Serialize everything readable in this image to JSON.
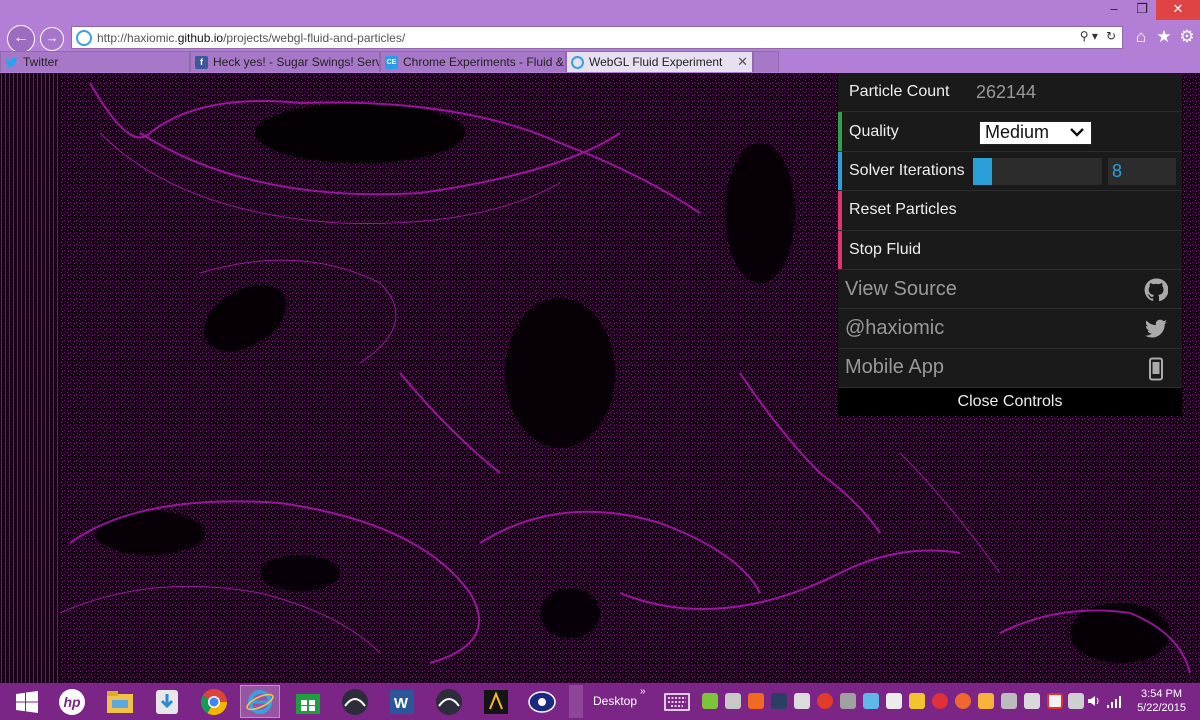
{
  "window": {
    "minimize": "–",
    "maximize": "❐",
    "close": "✕"
  },
  "nav": {
    "back": "←",
    "forward": "→"
  },
  "address": {
    "url_prefix": "http://haxiomic.",
    "url_domain": "github.io",
    "url_path": "/projects/webgl-fluid-and-particles/",
    "search_glyph": "⚲ ▾",
    "refresh_glyph": "↻"
  },
  "toolbar_icons": {
    "home": "⌂",
    "favorites": "★",
    "tools": "⚙"
  },
  "tabs": [
    {
      "label": "Twitter",
      "favicon": "twitter-icon",
      "color": "#2aa3ef"
    },
    {
      "label": "Heck yes! - Sugar Swings! Serv...",
      "favicon": "facebook-icon",
      "color": "#3b5998",
      "glyph": "f"
    },
    {
      "label": "Chrome Experiments - Fluid & ...",
      "favicon": "chrome-experiments-icon",
      "color": "#2d9be8",
      "glyph": "CE"
    },
    {
      "label": "WebGL Fluid Experiment",
      "favicon": "ie-icon",
      "color": "#3aa0e0",
      "active": true,
      "close": "✕"
    }
  ],
  "controls": {
    "particle_count_label": "Particle Count",
    "particle_count_value": "262144",
    "quality_label": "Quality",
    "quality_value": "Medium",
    "solver_label": "Solver Iterations",
    "solver_value": "8",
    "solver_fraction": 0.15,
    "reset_label": "Reset Particles",
    "stop_label": "Stop Fluid",
    "view_source_label": "View Source",
    "twitter_label": "@haxiomic",
    "mobile_label": "Mobile App",
    "close_label": "Close Controls"
  },
  "taskbar": {
    "desktop_label": "Desktop",
    "desktop_chevron": "»",
    "time": "3:54 PM",
    "date": "5/22/2015",
    "apps": [
      "windows-start-icon",
      "hp-icon",
      "file-explorer-icon",
      "download-icon",
      "chrome-icon",
      "internet-explorer-icon",
      "store-icon",
      "app-icon",
      "word-icon",
      "app-icon-2",
      "adobe-icon",
      "media-icon"
    ]
  },
  "colors": {
    "accent_green": "#2fa14a",
    "accent_blue": "#2a9fd8",
    "accent_pink": "#e2336f",
    "particles": "#c21bc6",
    "taskbar": "#7b2687",
    "chrome": "#b37fd6"
  }
}
